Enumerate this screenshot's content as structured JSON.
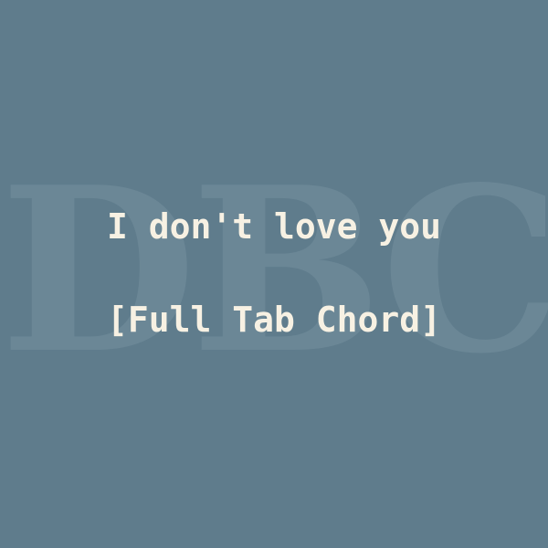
{
  "watermark": {
    "text": "DBC"
  },
  "title": {
    "line1": "I don't love you",
    "line2": "[Full Tab Chord]"
  },
  "colors": {
    "background": "#5f7c8c",
    "watermark": "#6b8796",
    "text": "#f7f1e3"
  }
}
